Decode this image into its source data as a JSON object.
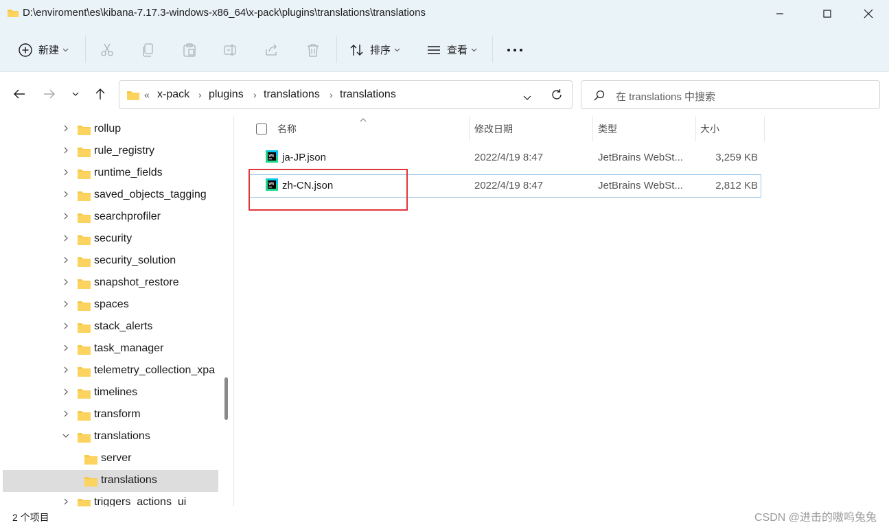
{
  "window": {
    "title": "D:\\enviroment\\es\\kibana-7.17.3-windows-x86_64\\x-pack\\plugins\\translations\\translations"
  },
  "toolbar": {
    "new_label": "新建",
    "sort_label": "排序",
    "view_label": "查看",
    "more_label": "···"
  },
  "address": {
    "overflow": "«",
    "crumbs": [
      "x-pack",
      "plugins",
      "translations",
      "translations"
    ],
    "separator": "›"
  },
  "search": {
    "placeholder": "在 translations 中搜索"
  },
  "sidebar": {
    "items": [
      {
        "label": "rollup"
      },
      {
        "label": "rule_registry"
      },
      {
        "label": "runtime_fields"
      },
      {
        "label": "saved_objects_tagging"
      },
      {
        "label": "searchprofiler"
      },
      {
        "label": "security"
      },
      {
        "label": "security_solution"
      },
      {
        "label": "snapshot_restore"
      },
      {
        "label": "spaces"
      },
      {
        "label": "stack_alerts"
      },
      {
        "label": "task_manager"
      },
      {
        "label": "telemetry_collection_xpa"
      },
      {
        "label": "timelines"
      },
      {
        "label": "transform"
      },
      {
        "label": "translations"
      },
      {
        "label": "server"
      },
      {
        "label": "translations"
      },
      {
        "label": "triggers_actions_ui"
      }
    ]
  },
  "columns": {
    "name": "名称",
    "modified": "修改日期",
    "type": "类型",
    "size": "大小"
  },
  "files": [
    {
      "name": "ja-JP.json",
      "modified": "2022/4/19 8:47",
      "type": "JetBrains WebSt...",
      "size": "3,259 KB"
    },
    {
      "name": "zh-CN.json",
      "modified": "2022/4/19 8:47",
      "type": "JetBrains WebSt...",
      "size": "2,812 KB"
    }
  ],
  "status": {
    "count": "2 个项目",
    "watermark": "CSDN @进击的嗷呜兔兔"
  },
  "colors": {
    "chrome": "#eaf3f8",
    "selection": "#dddddd",
    "highlight_border": "#9fc7e6",
    "annotation_red": "#e0353a",
    "folder": "#f7c948"
  }
}
